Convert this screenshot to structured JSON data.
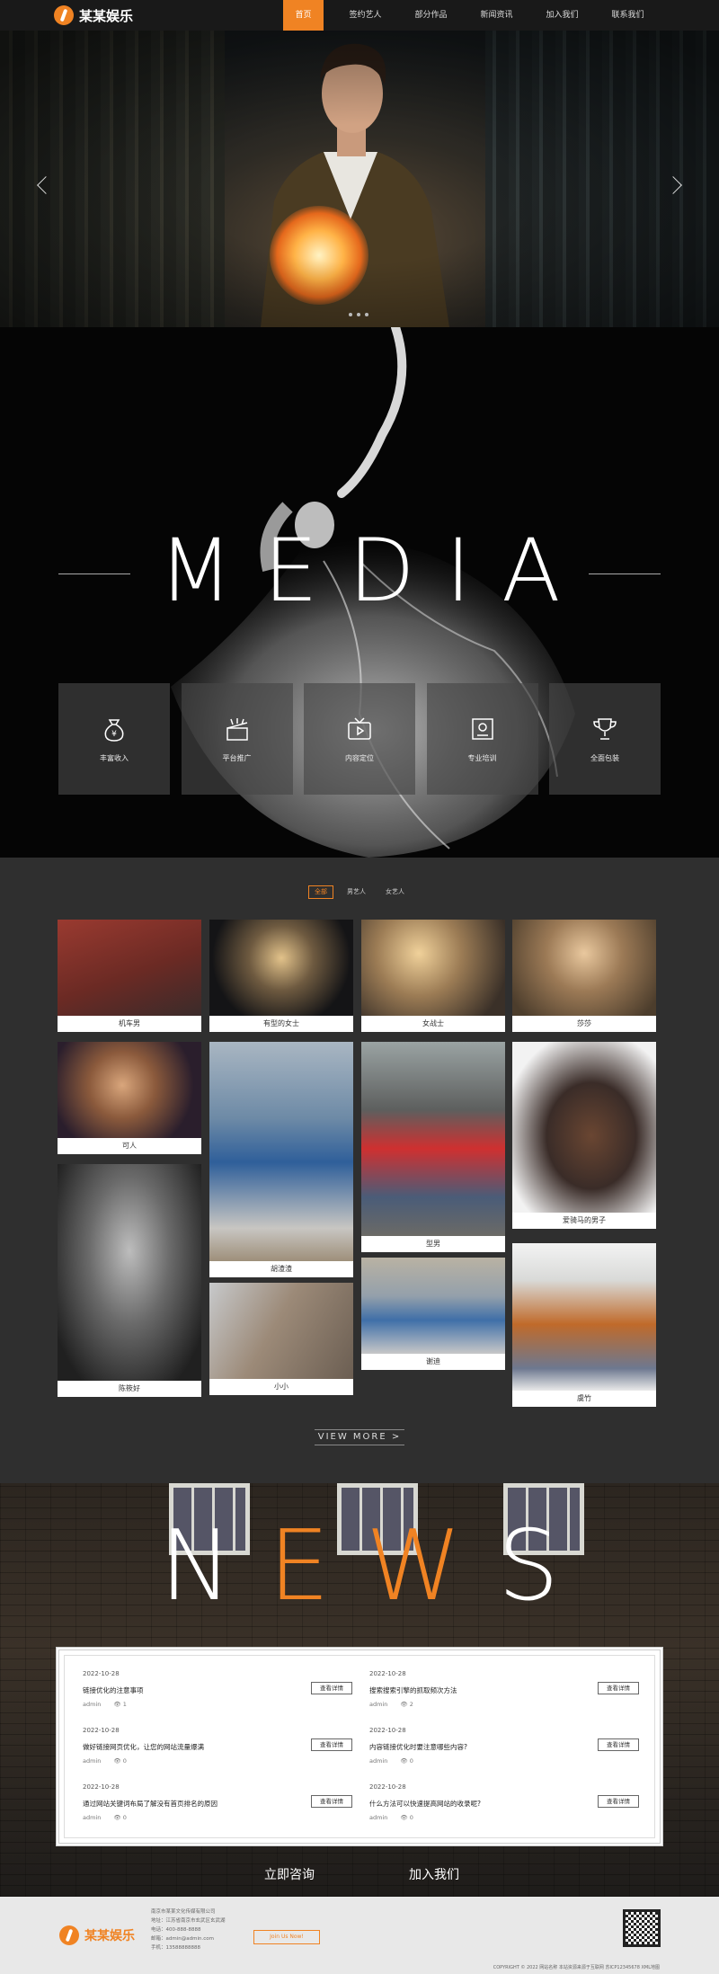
{
  "nav": {
    "logo_text": "某某娱乐",
    "items": [
      "首页",
      "签约艺人",
      "部分作品",
      "新闻资讯",
      "加入我们",
      "联系我们"
    ]
  },
  "hero": {
    "slide_count": 3,
    "active_slide": 1
  },
  "media": {
    "title": "MEDIA",
    "features": [
      {
        "label": "丰富收入",
        "icon": "money-bag-icon"
      },
      {
        "label": "平台推广",
        "icon": "megaphone-icon"
      },
      {
        "label": "内容定位",
        "icon": "tv-icon"
      },
      {
        "label": "专业培训",
        "icon": "certificate-icon"
      },
      {
        "label": "全面包装",
        "icon": "trophy-icon"
      }
    ]
  },
  "artists": {
    "filters": [
      "全部",
      "男艺人",
      "女艺人"
    ],
    "active_filter": "全部",
    "cards": [
      {
        "name": "机车男"
      },
      {
        "name": "有型的女士"
      },
      {
        "name": "女战士"
      },
      {
        "name": "莎莎"
      },
      {
        "name": "可人"
      },
      {
        "name": "胡渣渣"
      },
      {
        "name": "型男"
      },
      {
        "name": "爱骑马的男子"
      },
      {
        "name": "陈筱好"
      },
      {
        "name": "小小"
      },
      {
        "name": "谢迪"
      },
      {
        "name": "虞竹"
      }
    ],
    "view_more": "VIEW MORE >"
  },
  "news": {
    "title_parts": [
      "N",
      "E",
      "W",
      "S"
    ],
    "items": [
      {
        "date": "2022-10-28",
        "headline": "链接优化的注意事项",
        "author": "admin",
        "views": "1",
        "button": "查看详情"
      },
      {
        "date": "2022-10-28",
        "headline": "搜索搜索引擎的抓取频次方法",
        "author": "admin",
        "views": "2",
        "button": "查看详情"
      },
      {
        "date": "2022-10-28",
        "headline": "做好链接网页优化，让您的网站流量爆满",
        "author": "admin",
        "views": "0",
        "button": "查看详情"
      },
      {
        "date": "2022-10-28",
        "headline": "内容链接优化时要注意哪些内容?",
        "author": "admin",
        "views": "0",
        "button": "查看详情"
      },
      {
        "date": "2022-10-28",
        "headline": "通过网站关键词布局了解没有首页排名的原因",
        "author": "admin",
        "views": "0",
        "button": "查看详情"
      },
      {
        "date": "2022-10-28",
        "headline": "什么方法可以快速提高网站的收录呢?",
        "author": "admin",
        "views": "0",
        "button": "查看详情"
      }
    ],
    "cta_consult": "立即咨询",
    "cta_join": "加入我们"
  },
  "footer": {
    "logo_text": "某某娱乐",
    "company": "南京市某某文化传媒有限公司",
    "address": "地址：江苏省南京市玄武区玄武湖",
    "phone": "电话：400-888-8888",
    "email": "邮箱：admin@admin.com",
    "mobile": "手机：13588888888",
    "button": "Join Us Now!",
    "copyright": "COPYRIGHT © 2022 网站名称 本站资源来源于互联网 苏ICP12345678 XML地图"
  },
  "colors": {
    "accent": "#f08323",
    "dark": "#191919",
    "artist_bg": "#2f2f2f"
  }
}
